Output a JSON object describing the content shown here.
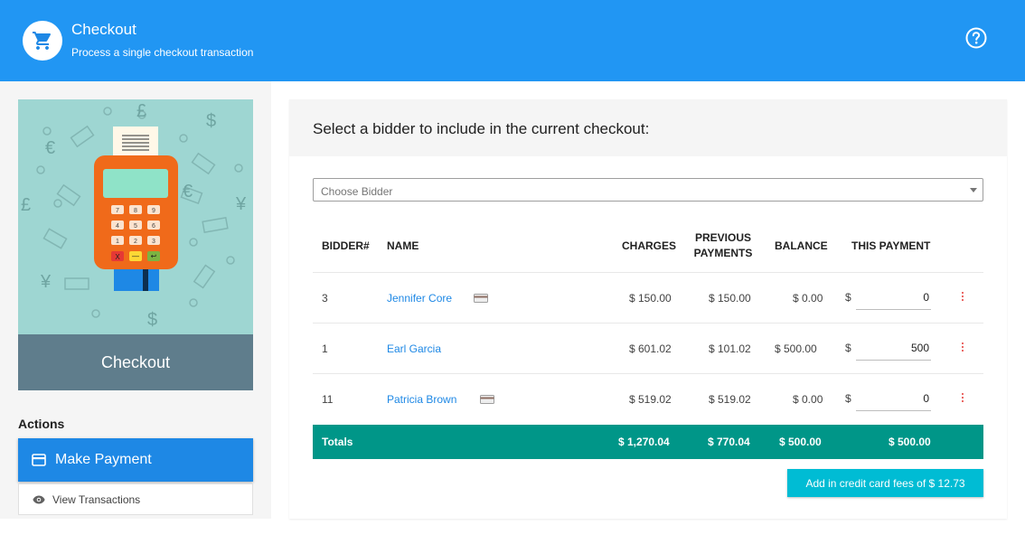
{
  "header": {
    "title": "Checkout",
    "subtitle": "Process a single checkout transaction",
    "logo_icon": "cart-icon",
    "help_icon": "help-icon",
    "bg_color": "#2196f3"
  },
  "sidebar": {
    "hero_caption": "Checkout",
    "actions_title": "Actions",
    "make_payment_label": "Make Payment",
    "make_payment_icon": "credit-card-icon",
    "view_transactions_label": "View Transactions",
    "view_transactions_icon": "eye-icon"
  },
  "main": {
    "heading": "Select a bidder to include in the current checkout:",
    "bidder_select_placeholder": "Choose Bidder",
    "columns": {
      "bidder": "BIDDER#",
      "name": "NAME",
      "charges": "CHARGES",
      "previous_line1": "PREVIOUS",
      "previous_line2": "PAYMENTS",
      "balance": "BALANCE",
      "this_payment": "THIS PAYMENT"
    },
    "rows": [
      {
        "bidder": "3",
        "name": "Jennifer Core",
        "has_card": true,
        "charges": "$ 150.00",
        "previous": "$ 150.00",
        "balance": "$ 0.00",
        "currency": "$",
        "payment": "0"
      },
      {
        "bidder": "1",
        "name": "Earl Garcia",
        "has_card": false,
        "charges": "$ 601.02",
        "previous": "$ 101.02",
        "balance": "$ 500.00",
        "currency": "$",
        "payment": "500"
      },
      {
        "bidder": "11",
        "name": "Patricia Brown",
        "has_card": true,
        "charges": "$ 519.02",
        "previous": "$ 519.02",
        "balance": "$ 0.00",
        "currency": "$",
        "payment": "0"
      }
    ],
    "totals": {
      "label": "Totals",
      "charges": "$ 1,270.04",
      "previous": "$ 770.04",
      "balance": "$ 500.00",
      "this_payment": "$ 500.00",
      "color": "#009688"
    },
    "fees_button_label": "Add in credit card fees of $ 12.73",
    "fees_button_color": "#00bcd4"
  }
}
